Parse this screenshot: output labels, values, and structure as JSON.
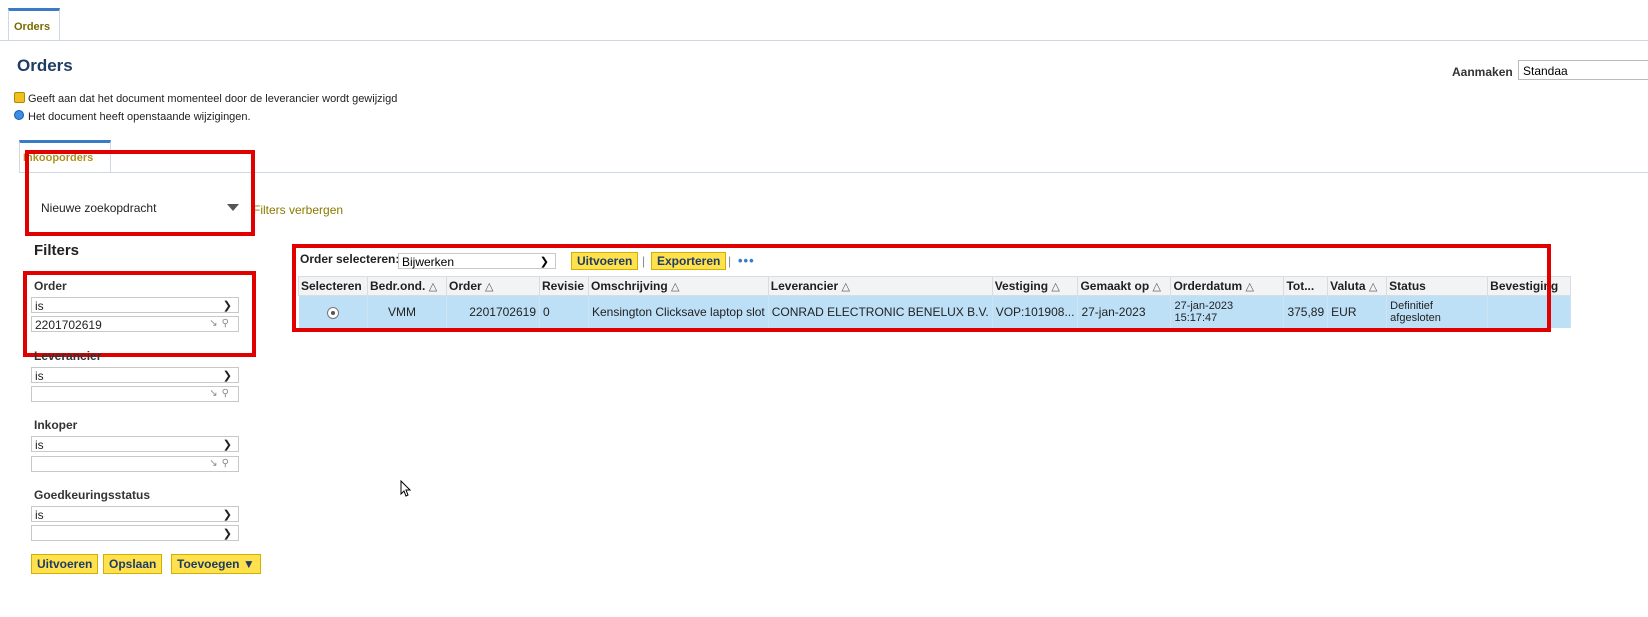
{
  "top_tab": "Orders",
  "page_title": "Orders",
  "aanmaken_label": "Aanmaken",
  "aanmaken_value": "Standaa",
  "legend": {
    "locked": "Geeft aan dat het document momenteel door de leverancier wordt gewijzigd",
    "pending": "Het document heeft openstaande wijzigingen."
  },
  "sub_tab": "Inkooporders",
  "search": {
    "value": "Nieuwe zoekopdracht",
    "hide_filters": "Filters verbergen"
  },
  "filters": {
    "title": "Filters",
    "order": {
      "label": "Order",
      "op": "is",
      "value": "2201702619"
    },
    "leverancier": {
      "label": "Leverancier",
      "op": "is",
      "value": ""
    },
    "inkoper": {
      "label": "Inkoper",
      "op": "is",
      "value": ""
    },
    "goedkeuring": {
      "label": "Goedkeuringsstatus",
      "op": "is",
      "value": ""
    },
    "buttons": {
      "run": "Uitvoeren",
      "save": "Opslaan",
      "add": "Toevoegen"
    }
  },
  "results": {
    "select_label": "Order selecteren:",
    "select_value": "Bijwerken",
    "run": "Uitvoeren",
    "export": "Exporteren",
    "more": "•••",
    "columns": [
      "Selecteren",
      "Bedr.ond.",
      "Order",
      "Revisie",
      "Omschrijving",
      "Leverancier",
      "Vestiging",
      "Gemaakt op",
      "Orderdatum",
      "Tot...",
      "Valuta",
      "Status",
      "Bevestiging"
    ],
    "row": {
      "bedr": "VMM",
      "order": "2201702619",
      "revisie": "0",
      "omschrijving": "Kensington Clicksave laptop slot",
      "leverancier": "CONRAD ELECTRONIC BENELUX B.V.",
      "vestiging": "VOP:101908...",
      "gemaakt": "27-jan-2023",
      "orderdatum_1": "27-jan-2023",
      "orderdatum_2": "15:17:47",
      "totaal": "375,89",
      "valuta": "EUR",
      "status_1": "Definitief",
      "status_2": "afgesloten",
      "bevestiging": ""
    }
  },
  "colors": {
    "accent": "#3a7bc8",
    "button_yellow": "#ffe14d",
    "highlight_row": "#bde0f7",
    "annotation_red": "#e00000"
  }
}
